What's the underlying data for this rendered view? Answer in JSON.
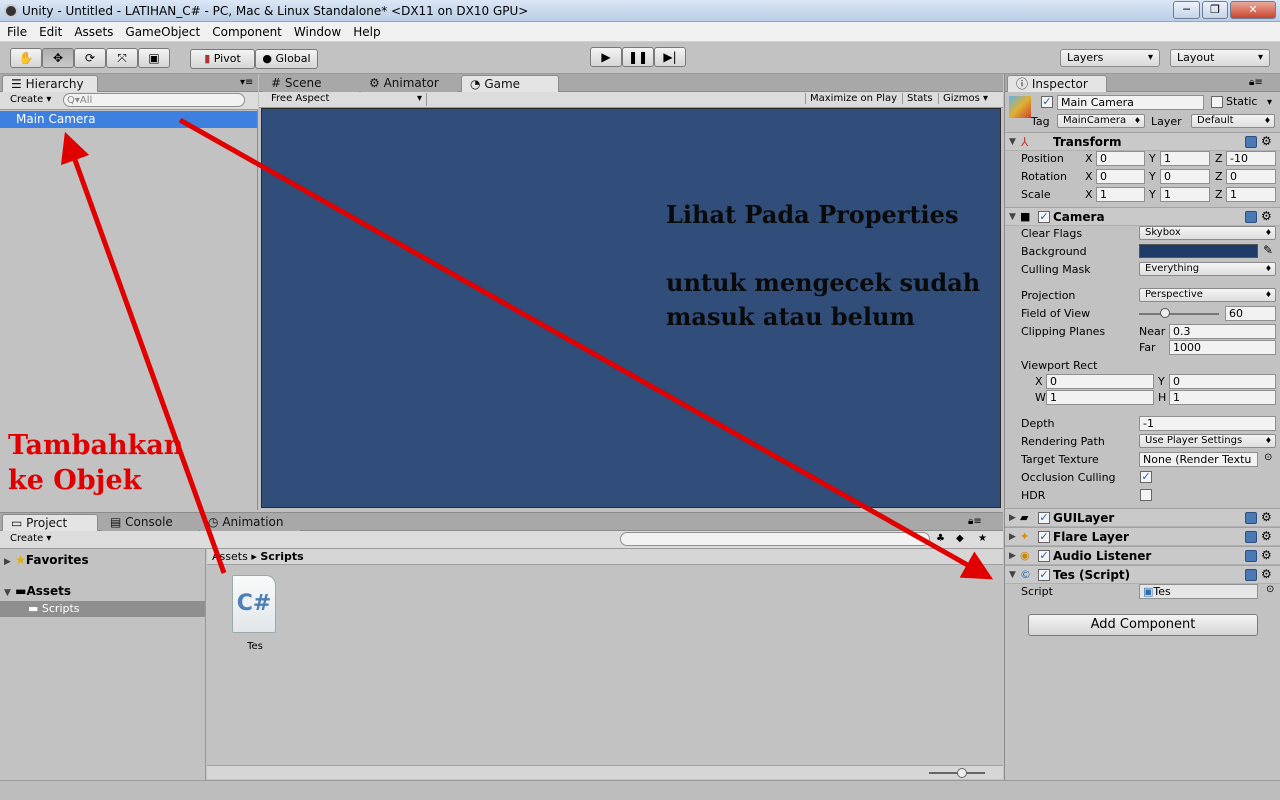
{
  "window": {
    "title": "Unity - Untitled - LATIHAN_C# - PC, Mac & Linux Standalone* <DX11 on DX10 GPU>",
    "minimize": "─",
    "maximize": "❐",
    "close": "✕"
  },
  "menu": [
    "File",
    "Edit",
    "Assets",
    "GameObject",
    "Component",
    "Window",
    "Help"
  ],
  "toolbar": {
    "pivot": "Pivot",
    "global": "Global",
    "layers": "Layers",
    "layout": "Layout"
  },
  "hierarchy": {
    "tab": "Hierarchy",
    "create": "Create",
    "search_placeholder": "Q▾All",
    "items": [
      "Main Camera"
    ]
  },
  "scene_tabs": {
    "scene": "Scene",
    "animator": "Animator",
    "game": "Game"
  },
  "game": {
    "aspect": "Free Aspect",
    "maximize": "Maximize on Play",
    "stats": "Stats",
    "gizmos": "Gizmos",
    "annotation": "Lihat Pada Properties\n\nuntuk mengecek sudah masuk atau belum",
    "bg": "#314d79"
  },
  "annotations": {
    "left": "Tambahkan ke Objek",
    "color": "#e00000"
  },
  "inspector": {
    "tab": "Inspector",
    "object_name": "Main Camera",
    "static": "Static",
    "tag_label": "Tag",
    "tag": "MainCamera",
    "layer_label": "Layer",
    "layer": "Default",
    "transform": {
      "title": "Transform",
      "position": {
        "label": "Position",
        "x": "0",
        "y": "1",
        "z": "-10"
      },
      "rotation": {
        "label": "Rotation",
        "x": "0",
        "y": "0",
        "z": "0"
      },
      "scale": {
        "label": "Scale",
        "x": "1",
        "y": "1",
        "z": "1"
      }
    },
    "camera": {
      "title": "Camera",
      "clear_flags_label": "Clear Flags",
      "clear_flags": "Skybox",
      "background_label": "Background",
      "background_color": "#1e3a66",
      "culling_mask_label": "Culling Mask",
      "culling_mask": "Everything",
      "projection_label": "Projection",
      "projection": "Perspective",
      "fov_label": "Field of View",
      "fov": "60",
      "fov_fraction": 0.26,
      "clipping_label": "Clipping Planes",
      "near_label": "Near",
      "near": "0.3",
      "far_label": "Far",
      "far": "1000",
      "viewport_label": "Viewport Rect",
      "vx": "0",
      "vy": "0",
      "vw": "1",
      "vh": "1",
      "depth_label": "Depth",
      "depth": "-1",
      "rendering_path_label": "Rendering Path",
      "rendering_path": "Use Player Settings",
      "target_texture_label": "Target Texture",
      "target_texture": "None (Render Textu",
      "occlusion_label": "Occlusion Culling",
      "hdr_label": "HDR",
      "x": "X",
      "y": "Y",
      "z": "Z",
      "w": "W",
      "h": "H"
    },
    "components": [
      "GUILayer",
      "Flare Layer",
      "Audio Listener",
      "Tes (Script)"
    ],
    "script_label": "Script",
    "script_value": "Tes",
    "add_component": "Add Component"
  },
  "project": {
    "tab_project": "Project",
    "tab_console": "Console",
    "tab_animation": "Animation",
    "create": "Create",
    "favorites": "Favorites",
    "assets": "Assets",
    "scripts": "Scripts",
    "breadcrumb_root": "Assets",
    "breadcrumb_sep": "▸",
    "breadcrumb_leaf": "Scripts",
    "file_name": "Tes",
    "file_glyph": "C#"
  }
}
